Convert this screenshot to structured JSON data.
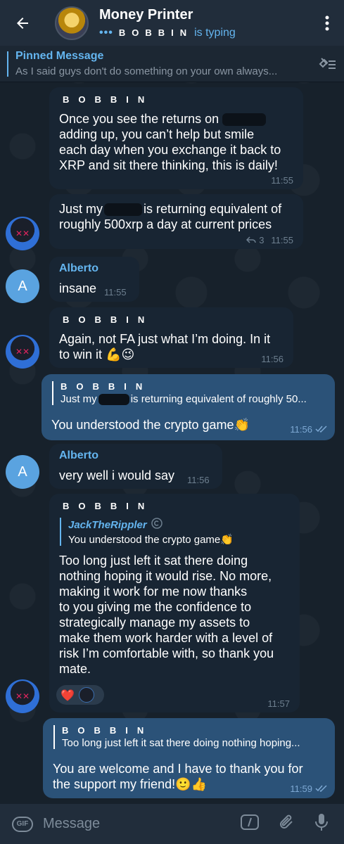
{
  "header": {
    "title": "Money Printer",
    "typing_dots": "•••",
    "typing_user": "BOBBIN",
    "typing_suffix": "is typing"
  },
  "pinned": {
    "title": "Pinned Message",
    "text": "As I said guys don't do something on your own always..."
  },
  "messages": [
    {
      "sender": "BOBBIN",
      "lines": [
        "Once you see the returns on",
        "adding up, you can’t help but smile",
        "each day when you exchange it back to",
        "XRP and sit there thinking, this is daily!"
      ],
      "time": "11:55"
    },
    {
      "text_before": "Just my",
      "text_after": "is returning equivalent of",
      "line2": "roughly 500xrp a day at current prices",
      "replies": "3",
      "time": "11:55"
    },
    {
      "sender": "Alberto",
      "text": "insane",
      "time": "11:55",
      "avatar_letter": "A"
    },
    {
      "sender": "BOBBIN",
      "line1": "Again, not FA just what I’m doing. In it",
      "line2": "to win it",
      "emojis": "💪😉",
      "time": "11:56"
    },
    {
      "reply_to": "BOBBIN",
      "reply_before": "Just my",
      "reply_after": "is returning equivalent of roughly 50...",
      "text": "You understood the crypto game",
      "emoji": "👏",
      "time": "11:56"
    },
    {
      "sender": "Alberto",
      "text": "very well i would say",
      "time": "11:56",
      "avatar_letter": "A"
    },
    {
      "sender": "BOBBIN",
      "reply_to": "JackTheRippler",
      "reply_text": "You understood the crypto game",
      "reply_emoji": "👏",
      "lines": [
        "Too long just left it sat there doing",
        "nothing hoping it would rise. No more,",
        "making it work for me now thanks",
        "to you giving me the confidence to",
        "strategically manage my assets to",
        "make them work harder with a level of",
        "risk I’m comfortable with, so thank you",
        "mate."
      ],
      "reaction": "❤️",
      "time": "11:57"
    },
    {
      "reply_to": "BOBBIN",
      "reply_text": "Too long just left it sat there doing nothing hoping...",
      "line1": "You are welcome and I have to thank you for",
      "line2": "the support my friend!",
      "emojis": "🙂👍",
      "time": "11:59"
    }
  ],
  "input": {
    "placeholder": "Message",
    "gif_label": "GIF"
  },
  "colors": {
    "accent": "#64b5ef",
    "incoming_bubble": "#182533",
    "outgoing_bubble": "#2b5278",
    "header_bg": "#212d3b"
  }
}
